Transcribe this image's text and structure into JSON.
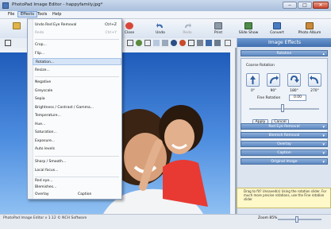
{
  "window": {
    "title": "PhotoPad Image Editor - happyfamily.jpg*"
  },
  "menubar": {
    "file": "File",
    "effects": "Effects",
    "tools": "Tools",
    "help": "Help"
  },
  "toolbar": {
    "close": "Close",
    "undo": "Undo",
    "redo": "Redo",
    "print": "Print",
    "slideshow": "Slide Show",
    "convert": "Convert",
    "photo_album": "Photo Album"
  },
  "effects_menu": [
    {
      "label": "Undo Red Eye Removal",
      "shortcut": "Ctrl+Z",
      "disabled": false
    },
    {
      "label": "Redo",
      "shortcut": "Ctrl+Y",
      "disabled": true
    },
    {
      "label": "Crop...",
      "shortcut": "",
      "disabled": false
    },
    {
      "label": "Flip...",
      "shortcut": "",
      "disabled": false
    },
    {
      "label": "Rotation...",
      "shortcut": "",
      "disabled": false
    },
    {
      "label": "Resize...",
      "shortcut": "",
      "disabled": false
    },
    {
      "label": "Negative",
      "shortcut": "",
      "disabled": false
    },
    {
      "label": "Greyscale",
      "shortcut": "",
      "disabled": false
    },
    {
      "label": "Sepia",
      "shortcut": "",
      "disabled": false
    },
    {
      "label": "Brightness / Contrast / Gamma...",
      "shortcut": "",
      "disabled": false
    },
    {
      "label": "Temperature...",
      "shortcut": "",
      "disabled": false
    },
    {
      "label": "Hue...",
      "shortcut": "",
      "disabled": false
    },
    {
      "label": "Saturation...",
      "shortcut": "",
      "disabled": false
    },
    {
      "label": "Exposure...",
      "shortcut": "",
      "disabled": false
    },
    {
      "label": "Auto levels",
      "shortcut": "",
      "disabled": false
    },
    {
      "label": "Sharp / Smooth...",
      "shortcut": "",
      "disabled": false
    },
    {
      "label": "Local focus...",
      "shortcut": "",
      "disabled": false
    },
    {
      "label": "Red eye...",
      "shortcut": "",
      "disabled": false
    },
    {
      "label": "Blemishes...",
      "shortcut": "",
      "disabled": false
    },
    {
      "label": "Overlay",
      "shortcut": "",
      "disabled": false
    },
    {
      "label": "Caption",
      "shortcut": "",
      "disabled": false
    }
  ],
  "panel": {
    "header": "Image Effects",
    "rotation_title": "Rotation",
    "coarse_label": "Coarse Rotation",
    "angles": [
      "0°",
      "90°",
      "180°",
      "270°"
    ],
    "fine_label": "Fine Rotation",
    "fine_value": "0.00",
    "apply": "Apply",
    "cancel": "Cancel",
    "sections": [
      "Red Eye Removal",
      "Blemish Removal",
      "Overlay",
      "Caption",
      "Original Image"
    ],
    "info_text": "Drag to fit? Unsaved(s) Using the rotation slider. For much more precise rotations, use the Fine rotation slider"
  },
  "status": {
    "text": "PhotoPad Image Editor v 1.12 © NCH Software",
    "zoom": "Zoom 85%"
  }
}
